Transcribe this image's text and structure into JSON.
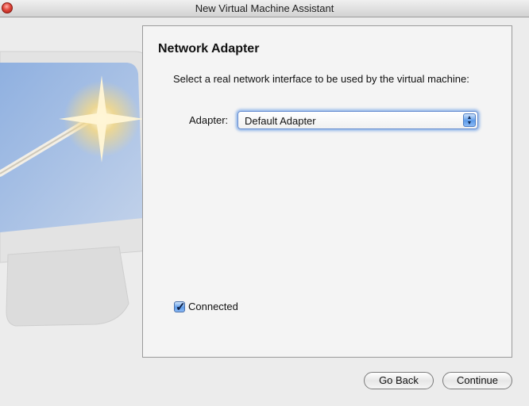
{
  "window": {
    "title": "New Virtual Machine Assistant"
  },
  "panel": {
    "title": "Network Adapter",
    "instruction": "Select a real network interface to be used by the virtual machine:",
    "adapter_label": "Adapter:",
    "adapter_value": "Default Adapter",
    "connected_label": "Connected",
    "connected_checked": true
  },
  "buttons": {
    "go_back": "Go Back",
    "continue": "Continue"
  },
  "colors": {
    "focus_ring": "#6ea0e6",
    "aqua_blue": "#5d9be9",
    "close_red": "#e0453a"
  },
  "icons": {
    "close": "close-icon",
    "select_arrows": "up-down-arrows-icon",
    "checkmark": "checkmark-icon",
    "decor": "wizard-monitor-illustration"
  }
}
